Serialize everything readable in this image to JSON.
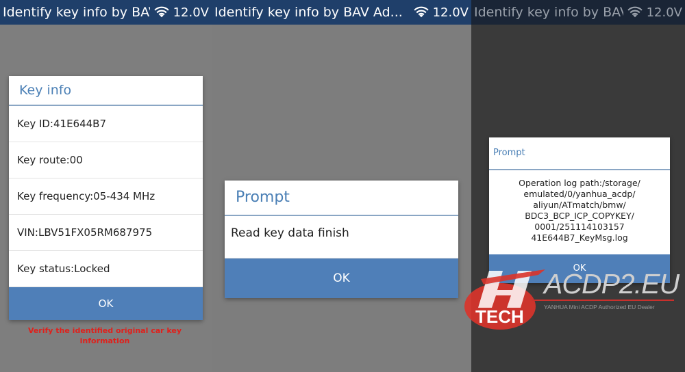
{
  "colors": {
    "accent_blue": "#4f7fb8",
    "title_blue": "#4a7fb5",
    "statusbar": "#1f3f6a",
    "caption_red": "#e0201b",
    "logo_red": "#d9342b"
  },
  "panels": [
    {
      "statusbar": {
        "title": "Identify key info by BAV Ad...",
        "voltage": "12.0V"
      },
      "dialog": {
        "title": "Key info",
        "rows": [
          "Key ID:41E644B7",
          "Key route:00",
          "Key frequency:05-434 MHz",
          "VIN:LBV51FX05RM687975",
          "Key status:Locked"
        ],
        "ok": "OK"
      },
      "caption": "Verify the identified original car key information"
    },
    {
      "statusbar": {
        "title": "Identify key info by BAV Ad...",
        "voltage": "12.0V"
      },
      "dialog": {
        "title": "Prompt",
        "message": "Read key data finish",
        "ok": "OK"
      }
    },
    {
      "statusbar": {
        "title": "Identify key info by BAV Ad...",
        "voltage": "12.0V"
      },
      "dialog": {
        "title": "Prompt",
        "message_lines": [
          "Operation log path:/storage/",
          "emulated/0/yanhua_acdp/",
          "aliyun/ATmatch/bmw/",
          "BDC3_BCP_ICP_COPYKEY/",
          "0001/251114103157",
          "41E644B7_KeyMsg.log"
        ],
        "ok": "OK"
      }
    }
  ],
  "watermark": {
    "logo_text": "TECH",
    "brand": "ACDP2.EU",
    "dealer": "YANHUA Mini ACDP Authorized EU Dealer"
  },
  "icons": {
    "signal": "wifi-icon",
    "logo": "yh-tech-logo"
  }
}
